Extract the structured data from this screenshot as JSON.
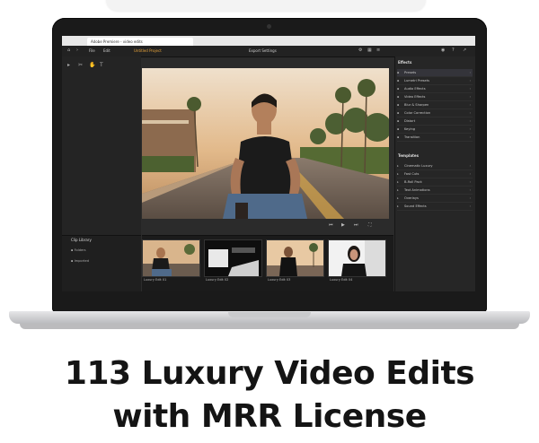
{
  "app": {
    "tab_title": "Adobe Premiere - video edits",
    "window_title": "Untitled Project",
    "toolbar_labels": [
      "File",
      "Edit"
    ],
    "toolbar_center": "Export Settings"
  },
  "right_panel": {
    "effects_header": "Effects",
    "effects_items": [
      {
        "label": "Presets",
        "icon": "folder-icon"
      },
      {
        "label": "Lumetri Presets",
        "icon": "folder-icon"
      },
      {
        "label": "Audio Effects",
        "icon": "folder-icon"
      },
      {
        "label": "Video Effects",
        "icon": "folder-icon"
      },
      {
        "label": "Blur & Sharpen",
        "icon": "folder-icon"
      },
      {
        "label": "Color Correction",
        "icon": "folder-icon"
      },
      {
        "label": "Distort",
        "icon": "folder-icon"
      },
      {
        "label": "Keying",
        "icon": "folder-icon"
      },
      {
        "label": "Transition",
        "icon": "folder-icon"
      }
    ],
    "templates_header": "Templates",
    "template_items": [
      {
        "label": "Cinematic Luxury",
        "icon": "film-icon"
      },
      {
        "label": "Fast Cuts",
        "icon": "film-icon"
      },
      {
        "label": "B-Roll Pack",
        "icon": "film-icon"
      },
      {
        "label": "Text Animations",
        "icon": "film-icon"
      },
      {
        "label": "Overlays",
        "icon": "film-icon"
      },
      {
        "label": "Sound Effects",
        "icon": "film-icon"
      }
    ]
  },
  "bottom_left": {
    "header": "Clip Library",
    "rows": [
      "Folders",
      "Imported"
    ]
  },
  "thumbnails": [
    {
      "label": "Luxury Edit 01"
    },
    {
      "label": "Luxury Edit 02"
    },
    {
      "label": "Luxury Edit 03"
    },
    {
      "label": "Luxury Edit 04"
    }
  ],
  "headline": {
    "line1": "113 Luxury Video Edits",
    "line2": "with MRR License"
  }
}
